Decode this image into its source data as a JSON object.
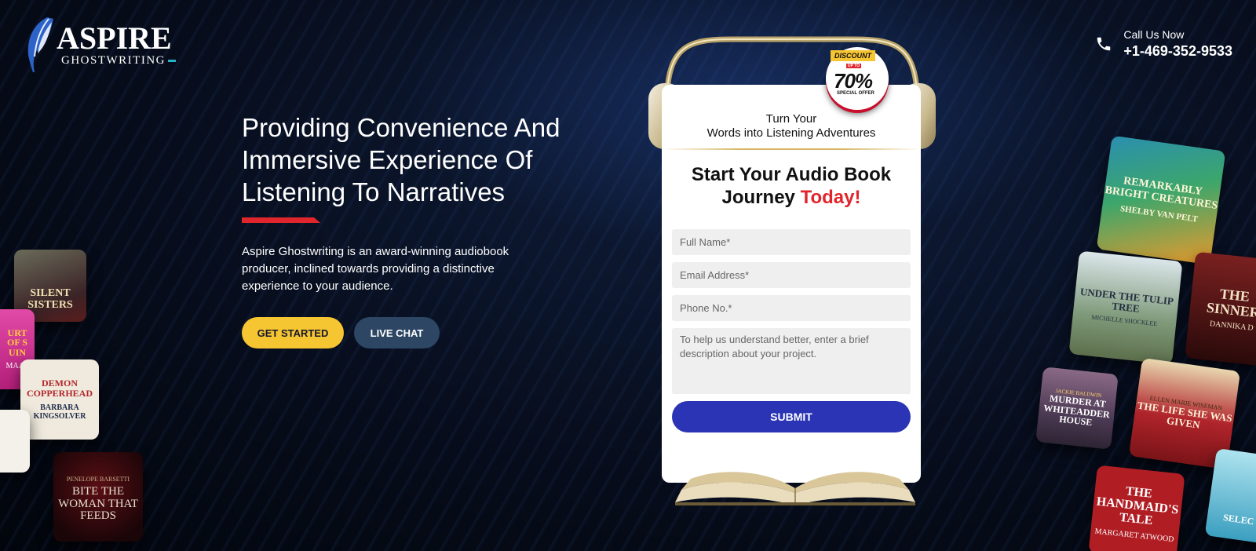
{
  "brand": {
    "name": "ASPIRE",
    "subtitle": "GHOSTWRITING"
  },
  "contact": {
    "label": "Call Us Now",
    "phone": "+1-469-352-9533"
  },
  "hero": {
    "headline": "Providing Convenience And Immersive Experience Of Listening To Narratives",
    "description": "Aspire Ghostwriting is an award-winning audiobook producer, inclined towards providing a distinctive experience to your audience.",
    "get_started": "GET STARTED",
    "live_chat": "LIVE CHAT"
  },
  "badge": {
    "tag": "DISCOUNT",
    "upto": "UP TO",
    "percent": "70%",
    "special": "SPECIAL OFFER"
  },
  "form": {
    "lead_line1": "Turn Your",
    "lead_line2": "Words into Listening Adventures",
    "heading_main": "Start Your Audio Book Journey",
    "heading_accent": "Today!",
    "name_placeholder": "Full Name*",
    "email_placeholder": "Email Address*",
    "phone_placeholder": "Phone No.*",
    "message_placeholder": "To help us understand better, enter a brief description about your project.",
    "submit": "SUBMIT"
  },
  "covers": {
    "silent_sisters": {
      "title": "SILENT SISTERS"
    },
    "court": {
      "title": "URT OF S UIN",
      "author": "MAAS"
    },
    "demon": {
      "title": "DEMON COPPERHEAD",
      "author": "BARBARA KINGSOLVER"
    },
    "bite": {
      "title": "BITE THE WOMAN THAT FEEDS",
      "author": "PENELOPE BARSETTI"
    },
    "remarkably": {
      "title": "REMARKABLY BRIGHT CREATURES",
      "author": "SHELBY VAN PELT"
    },
    "tulip": {
      "title": "UNDER THE TULIP TREE",
      "author": "MICHELLE SHOCKLEE"
    },
    "sinner": {
      "title": "THE SINNER",
      "author": "DANNIKA D"
    },
    "murder": {
      "title": "MURDER AT WHITEADDER HOUSE",
      "author": "JACKIE BALDWIN"
    },
    "life": {
      "title": "THE LIFE SHE WAS GIVEN",
      "author": "ELLEN MARIE WISEMAN"
    },
    "handmaid": {
      "title": "THE HANDMAID'S TALE",
      "author": "MARGARET ATWOOD"
    },
    "selection": {
      "title": "SELEC"
    }
  },
  "colors": {
    "accent_red": "#e1252d",
    "accent_yellow": "#f6c532",
    "submit_blue": "#2a34b4",
    "chat_blue": "#2c4664"
  }
}
